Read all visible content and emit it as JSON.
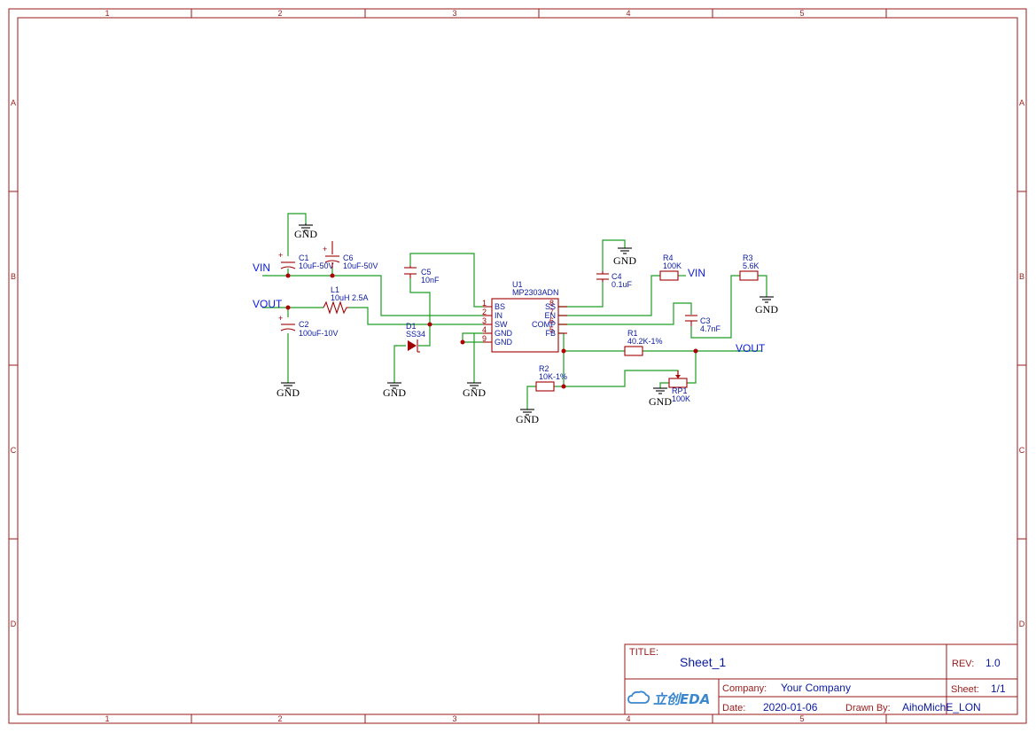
{
  "frame": {
    "col_labels": [
      "1",
      "2",
      "3",
      "4",
      "5"
    ],
    "row_labels": [
      "A",
      "B",
      "C",
      "D"
    ]
  },
  "title_block": {
    "title_label": "TITLE:",
    "title_value": "Sheet_1",
    "rev_label": "REV:",
    "rev_value": "1.0",
    "company_label": "Company:",
    "company_value": "Your Company",
    "sheet_label": "Sheet:",
    "sheet_value": "1/1",
    "date_label": "Date:",
    "date_value": "2020-01-06",
    "drawn_label": "Drawn By:",
    "drawn_value": "AihoMichE_LON",
    "logo_text": "立创EDA"
  },
  "schematic": {
    "nets": {
      "vin_left": "VIN",
      "vout_left": "VOUT",
      "vin_right": "VIN",
      "vout_right": "VOUT"
    },
    "gnd_label": "GND",
    "components": {
      "c1": {
        "ref": "C1",
        "value": "10uF-50V"
      },
      "c6": {
        "ref": "C6",
        "value": "10uF-50V"
      },
      "c2": {
        "ref": "C2",
        "value": "100uF-10V"
      },
      "c5": {
        "ref": "C5",
        "value": "10nF"
      },
      "c4": {
        "ref": "C4",
        "value": "0.1uF"
      },
      "c3": {
        "ref": "C3",
        "value": "4.7nF"
      },
      "l1": {
        "ref": "L1",
        "value": "10uH 2.5A"
      },
      "d1": {
        "ref": "D1",
        "value": "SS34"
      },
      "u1": {
        "ref": "U1",
        "value": "MP2303ADN"
      },
      "r1": {
        "ref": "R1",
        "value": "40.2K-1%"
      },
      "r2": {
        "ref": "R2",
        "value": "10K-1%"
      },
      "r3": {
        "ref": "R3",
        "value": "5.6K"
      },
      "r4": {
        "ref": "R4",
        "value": "100K"
      },
      "rp1": {
        "ref": "RP1",
        "value": "100K"
      }
    },
    "u1_pins_left": [
      {
        "num": "1",
        "name": "BS"
      },
      {
        "num": "2",
        "name": "IN"
      },
      {
        "num": "3",
        "name": "SW"
      },
      {
        "num": "4",
        "name": "GND"
      },
      {
        "num": "9",
        "name": "GND"
      }
    ],
    "u1_pins_right": [
      {
        "num": "8",
        "name": "SS"
      },
      {
        "num": "7",
        "name": "EN"
      },
      {
        "num": "6",
        "name": "COMP"
      },
      {
        "num": "5",
        "name": "FB"
      }
    ]
  }
}
